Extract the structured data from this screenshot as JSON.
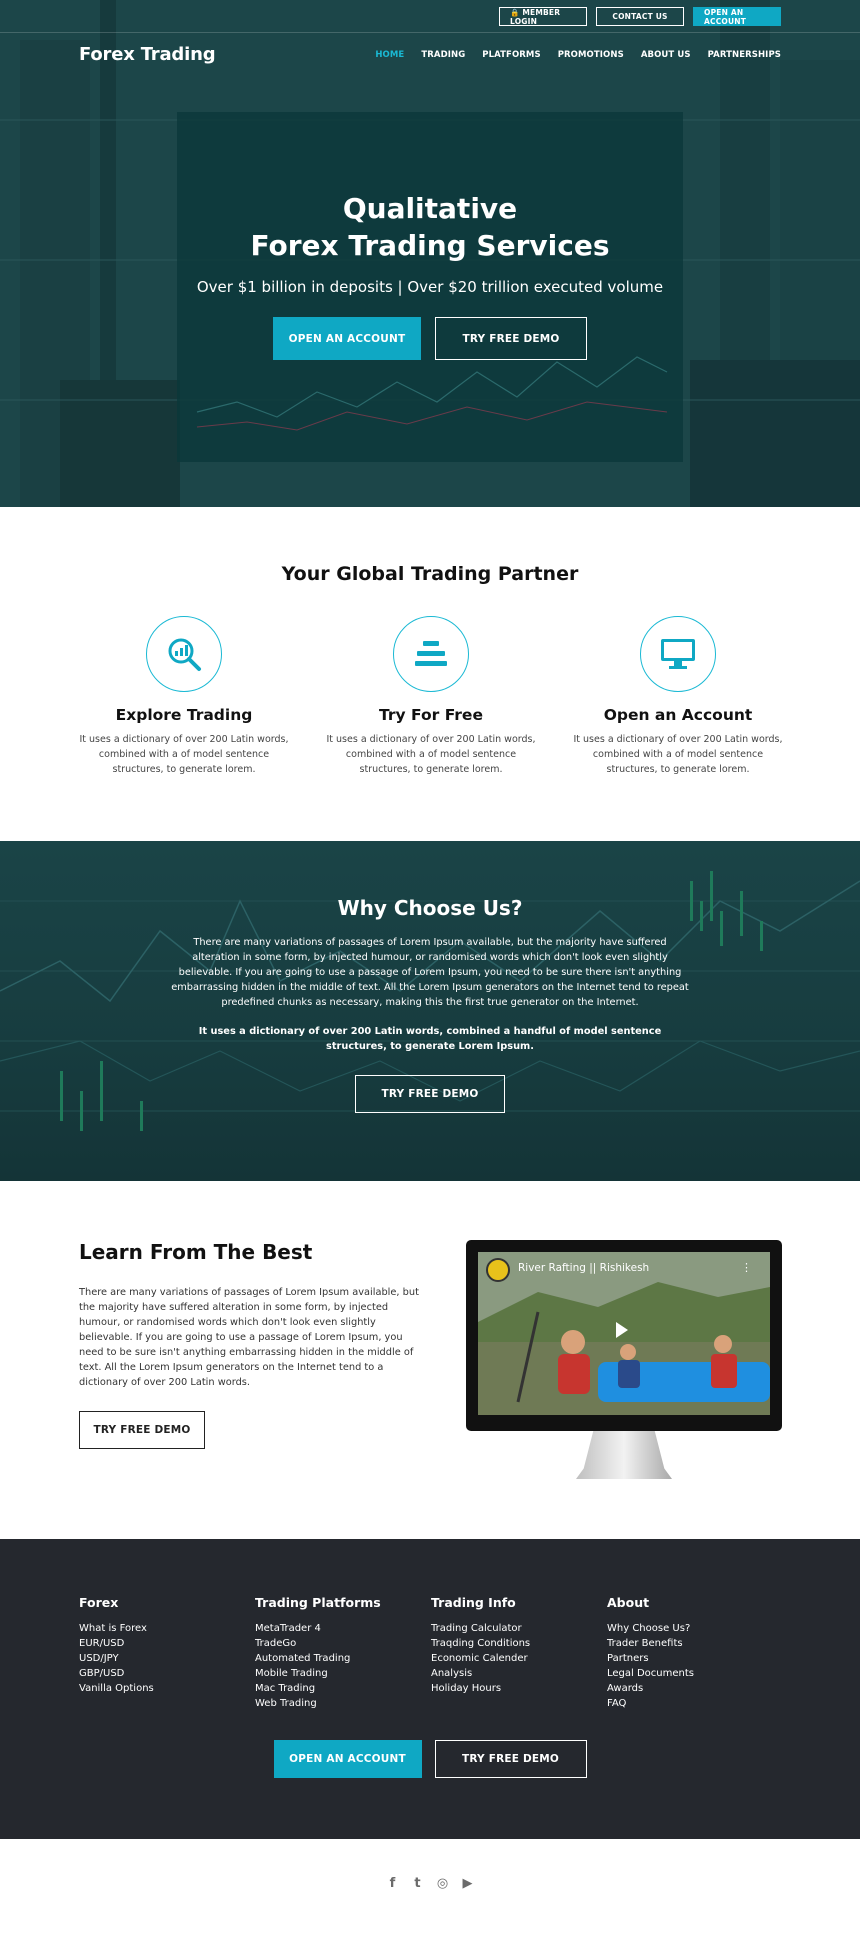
{
  "topbar": {
    "member_login": "🔒 MEMBER LOGIN",
    "contact_us": "CONTACT US",
    "open_account": "OPEN AN ACCOUNT"
  },
  "header": {
    "logo": "Forex Trading",
    "nav": [
      "HOME",
      "TRADING",
      "PLATFORMS",
      "PROMOTIONS",
      "ABOUT US",
      "PARTNERSHIPS"
    ],
    "active": "HOME"
  },
  "hero": {
    "title_line1": "Qualitative",
    "title_line2": "Forex Trading Services",
    "subtitle": "Over $1 billion in deposits | Over $20 trillion executed volume",
    "primary_button": "OPEN AN ACCOUNT",
    "secondary_button": "TRY FREE DEMO"
  },
  "partner": {
    "title": "Your Global Trading Partner",
    "features": [
      {
        "icon": "analytics-search-icon",
        "title": "Explore Trading",
        "text": "It uses a dictionary of over 200 Latin words, combined with a of model sentence structures, to generate lorem."
      },
      {
        "icon": "stack-bars-icon",
        "title": "Try For Free",
        "text": "It uses a dictionary of over 200 Latin words, combined with a of model sentence structures, to generate lorem."
      },
      {
        "icon": "monitor-icon",
        "title": "Open an Account",
        "text": "It uses a dictionary of over 200 Latin words, combined with a of model sentence structures, to generate lorem."
      }
    ]
  },
  "why": {
    "title": "Why Choose Us?",
    "paragraph": "There are many variations of passages of Lorem Ipsum available, but the majority have suffered alteration in some form, by injected humour, or randomised words which don't look even slightly believable. If you are going to use a passage of Lorem Ipsum, you need to be sure there isn't anything embarrassing hidden in the middle of text. All the Lorem Ipsum generators on the Internet tend to repeat predefined chunks as necessary, making this the first true generator on the Internet.",
    "bold_paragraph": "It uses a dictionary of over 200 Latin words, combined a handful of model sentence structures, to generate Lorem Ipsum.",
    "button": "TRY FREE DEMO"
  },
  "learn": {
    "title": "Learn From The Best",
    "paragraph": "There are many variations of passages of Lorem Ipsum available, but the majority have suffered alteration in some form, by injected humour, or randomised words which don't look even slightly believable. If you are going to use a passage of Lorem Ipsum, you need to be sure isn't anything embarrassing hidden in the middle of text. All the Lorem Ipsum generators on the Internet tend to a dictionary of over 200 Latin words.",
    "button": "TRY FREE DEMO",
    "video_title": "River Rafting || Rishikesh"
  },
  "footer": {
    "columns": [
      {
        "title": "Forex",
        "items": [
          "What is Forex",
          "EUR/USD",
          "USD/JPY",
          "GBP/USD",
          "Vanilla Options"
        ]
      },
      {
        "title": "Trading Platforms",
        "items": [
          "MetaTrader 4",
          "TradeGo",
          "Automated Trading",
          "Mobile Trading",
          "Mac Trading",
          "Web Trading"
        ]
      },
      {
        "title": "Trading Info",
        "items": [
          "Trading Calculator",
          "Traqding Conditions",
          "Economic Calender",
          "Analysis",
          "Holiday Hours"
        ]
      },
      {
        "title": "About",
        "items": [
          "Why Choose Us?",
          "Trader Benefits",
          "Partners",
          "Legal Documents",
          "Awards",
          "FAQ"
        ]
      }
    ],
    "primary_button": "OPEN AN ACCOUNT",
    "secondary_button": "TRY FREE DEMO"
  },
  "socials": {
    "facebook": "f",
    "twitter": "t",
    "instagram": "◎",
    "youtube": "▶"
  },
  "colors": {
    "accent": "#0fa8c4",
    "hero_bg": "#1e4a4d",
    "footer_bg": "#25282e"
  }
}
